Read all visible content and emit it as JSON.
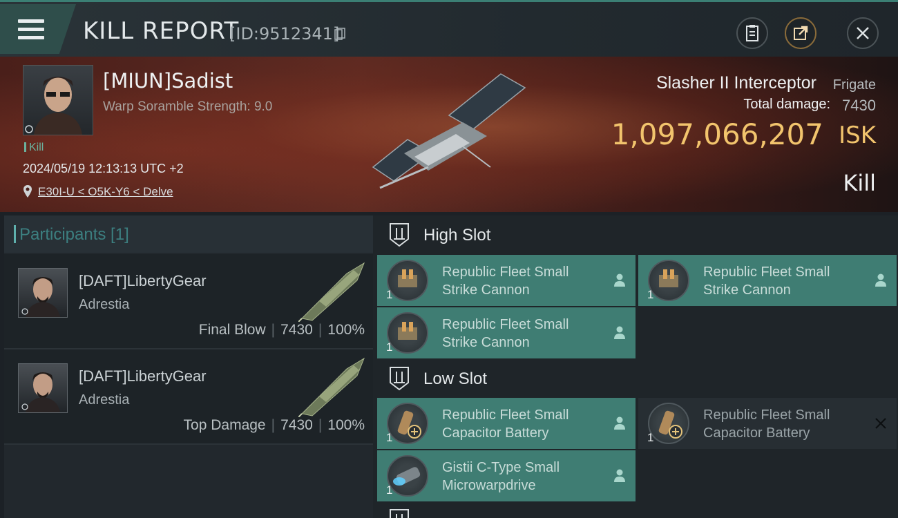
{
  "header": {
    "title": "KILL REPORT",
    "report_id": "[ID:9512341]"
  },
  "victim": {
    "name": "[MIUN]Sadist",
    "stat": "Warp Soramble Strength: 9.0",
    "badge": "Kill",
    "datetime": "2024/05/19 12:13:13 UTC +2",
    "location": "E30I-U < O5K-Y6 < Delve",
    "ship_name": "Slasher II Interceptor",
    "ship_class": "Frigate",
    "total_damage_label": "Total damage:",
    "total_damage": "7430",
    "isk_value": "1,097,066,207",
    "isk_unit": "ISK",
    "kill_type": "Kill"
  },
  "participants": {
    "title": "Participants [1]",
    "rows": [
      {
        "name": "[DAFT]LibertyGear",
        "corp": "Adrestia",
        "label": "Final Blow",
        "damage": "7430",
        "percent": "100%"
      },
      {
        "name": "[DAFT]LibertyGear",
        "corp": "Adrestia",
        "label": "Top Damage",
        "damage": "7430",
        "percent": "100%"
      }
    ]
  },
  "slots": {
    "high": {
      "title": "High Slot",
      "modules": [
        {
          "name_l1": "Republic Fleet Small",
          "name_l2": "Strike Cannon",
          "qty": "1"
        },
        {
          "name_l1": "Republic Fleet Small",
          "name_l2": "Strike Cannon",
          "qty": "1"
        },
        {
          "name_l1": "Republic Fleet Small",
          "name_l2": "Strike Cannon",
          "qty": "1"
        }
      ]
    },
    "low": {
      "title": "Low Slot",
      "modules": [
        {
          "name_l1": "Republic Fleet Small",
          "name_l2": "Capacitor Battery",
          "qty": "1"
        },
        {
          "name_l1": "Republic Fleet Small",
          "name_l2": "Capacitor Battery",
          "qty": "1"
        },
        {
          "name_l1": "Gistii C-Type Small",
          "name_l2": "Microwarpdrive",
          "qty": "1"
        }
      ]
    }
  },
  "colors": {
    "accent": "#3f7d73",
    "isk": "#f2c46d"
  }
}
